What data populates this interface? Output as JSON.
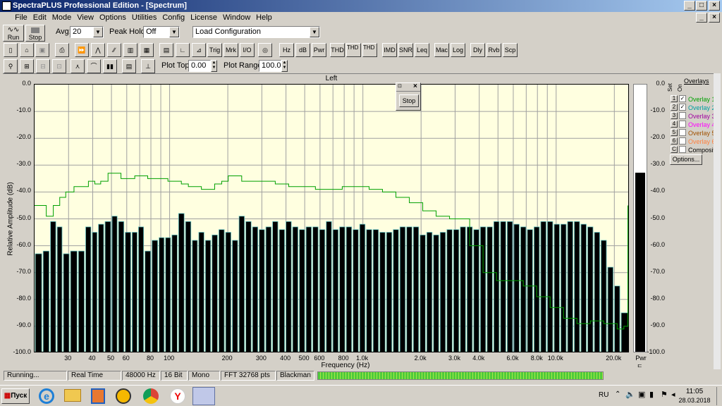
{
  "window": {
    "title": "SpectraPLUS Professional Edition - [Spectrum]",
    "menu": [
      "File",
      "Edit",
      "Mode",
      "View",
      "Options",
      "Utilities",
      "Config",
      "License",
      "Window",
      "Help"
    ]
  },
  "toolbar": {
    "run_label": "Run",
    "stop_label": "Stop",
    "avg_label": "Avg:",
    "avg_value": "20",
    "peak_hold_label": "Peak Hold:",
    "peak_hold_value": "Off",
    "config_value": "Load Configuration",
    "buttons_row2": [
      "Trig",
      "Mrk",
      "I/O",
      "Hz",
      "dB",
      "Pwr",
      "THD",
      "THD +N",
      "THD Freq",
      "IMD",
      "SNR",
      "Leq",
      "Mac",
      "Log",
      "Dly",
      "Rvb",
      "Scp"
    ],
    "plot_top_label": "Plot Top:",
    "plot_top_value": "0.00",
    "plot_range_label": "Plot Range:",
    "plot_range_value": "100.0"
  },
  "plot": {
    "channel_title": "Left",
    "ylabel": "Relative Amplitude (dB)",
    "xlabel": "Frequency (Hz)",
    "right_label": "Pwr",
    "floating_stop_label": "Stop",
    "y_ticks": [
      "0.0",
      "-10.0",
      "-20.0",
      "-30.0",
      "-40.0",
      "-50.0",
      "-60.0",
      "-70.0",
      "-80.0",
      "-90.0",
      "-100.0"
    ],
    "x_ticks": [
      "30",
      "40",
      "50",
      "60",
      "80",
      "100",
      "200",
      "300",
      "400",
      "500",
      "600",
      "800",
      "1.0k",
      "2.0k",
      "3.0k",
      "4.0k",
      "6.0k",
      "8.0k",
      "10.0k",
      "20.0k"
    ],
    "x_tick_freqs": [
      30,
      40,
      50,
      60,
      80,
      100,
      200,
      300,
      400,
      500,
      600,
      800,
      1000,
      2000,
      3000,
      4000,
      6000,
      8000,
      10000,
      20000
    ]
  },
  "overlays": {
    "title": "Overlays",
    "col_set": "Set",
    "col_on": "On",
    "items": [
      {
        "num": "1",
        "label": "Overlay 1",
        "checked": true,
        "color": "#00a000"
      },
      {
        "num": "2",
        "label": "Overlay 2",
        "checked": true,
        "color": "#00a0a0"
      },
      {
        "num": "3",
        "label": "Overlay 3",
        "checked": false,
        "color": "#a000a0"
      },
      {
        "num": "4",
        "label": "Overlay 4",
        "checked": false,
        "color": "#ff00ff"
      },
      {
        "num": "5",
        "label": "Overlay 5",
        "checked": false,
        "color": "#a05000"
      },
      {
        "num": "6",
        "label": "Overlay 6",
        "checked": false,
        "color": "#ff8040"
      },
      {
        "num": "C",
        "label": "Composite",
        "checked": false,
        "color": "#000000"
      }
    ],
    "options_label": "Options..."
  },
  "status": {
    "state": "Running...",
    "mode": "Real Time",
    "rate": "48000 Hz",
    "bits": "16 Bit",
    "channels": "Mono",
    "fft": "FFT 32768 pts",
    "window": "Blackman"
  },
  "taskbar": {
    "start_label": "Пуск",
    "lang": "RU",
    "time": "11:05",
    "date": "28.03.2018"
  },
  "chart_data": {
    "type": "bar",
    "ylim": [
      -100,
      0
    ],
    "xlim_hz": [
      20,
      24000
    ],
    "x_scale": "log",
    "bar_freqs": [
      21,
      23,
      25,
      27,
      29,
      32,
      35,
      38,
      41,
      44,
      48,
      52,
      56,
      61,
      66,
      71,
      77,
      84,
      91,
      98,
      106,
      115,
      125,
      135,
      146,
      158,
      171,
      186,
      201,
      218,
      236,
      256,
      277,
      300,
      325,
      352,
      381,
      413,
      447,
      484,
      525,
      568,
      616,
      667,
      722,
      782,
      847,
      918,
      994,
      1077,
      1166,
      1263,
      1368,
      1482,
      1605,
      1739,
      1883,
      2040,
      2210,
      2393,
      2592,
      2808,
      3041,
      3294,
      3568,
      3865,
      4186,
      4534,
      4911,
      5320,
      5762,
      6241,
      6760,
      7322,
      7931,
      8591,
      9305,
      10079,
      10917,
      11825,
      12808,
      13873,
      15027,
      16276,
      17630,
      19096,
      20684,
      22404
    ],
    "bar_values": [
      -63,
      -62,
      -51,
      -53,
      -63,
      -62,
      -62,
      -53,
      -55,
      -52,
      -51,
      -49,
      -51,
      -55,
      -55,
      -53,
      -62,
      -58,
      -57,
      -57,
      -56,
      -48,
      -51,
      -58,
      -55,
      -58,
      -56,
      -54,
      -55,
      -58,
      -49,
      -51,
      -53,
      -54,
      -53,
      -51,
      -54,
      -51,
      -53,
      -54,
      -53,
      -53,
      -54,
      -51,
      -54,
      -53,
      -53,
      -54,
      -52,
      -54,
      -54,
      -55,
      -55,
      -54,
      -53,
      -53,
      -53,
      -56,
      -55,
      -56,
      -55,
      -54,
      -54,
      -53,
      -53,
      -54,
      -53,
      -53,
      -51,
      -51,
      -51,
      -52,
      -53,
      -54,
      -53,
      -51,
      -51,
      -52,
      -52,
      -51,
      -51,
      -52,
      -53,
      -55,
      -58,
      -68,
      -75,
      -85
    ],
    "overlay1": [
      [
        20,
        -45
      ],
      [
        22,
        -45
      ],
      [
        23,
        -49
      ],
      [
        25,
        -45
      ],
      [
        27,
        -42
      ],
      [
        29,
        -40
      ],
      [
        32,
        -38
      ],
      [
        35,
        -38
      ],
      [
        38,
        -36
      ],
      [
        41,
        -37
      ],
      [
        44,
        -36
      ],
      [
        48,
        -33
      ],
      [
        52,
        -33
      ],
      [
        56,
        -35
      ],
      [
        61,
        -35
      ],
      [
        66,
        -34
      ],
      [
        71,
        -34
      ],
      [
        77,
        -35
      ],
      [
        84,
        -35
      ],
      [
        91,
        -35
      ],
      [
        98,
        -36
      ],
      [
        106,
        -36
      ],
      [
        115,
        -37
      ],
      [
        125,
        -38
      ],
      [
        135,
        -38
      ],
      [
        146,
        -39
      ],
      [
        158,
        -39
      ],
      [
        171,
        -37
      ],
      [
        186,
        -36
      ],
      [
        201,
        -34
      ],
      [
        218,
        -34
      ],
      [
        236,
        -36
      ],
      [
        256,
        -36
      ],
      [
        300,
        -36
      ],
      [
        352,
        -37
      ],
      [
        413,
        -38
      ],
      [
        484,
        -38
      ],
      [
        568,
        -39
      ],
      [
        667,
        -39
      ],
      [
        782,
        -38
      ],
      [
        918,
        -38
      ],
      [
        1077,
        -39
      ],
      [
        1263,
        -40
      ],
      [
        1482,
        -42
      ],
      [
        1739,
        -44
      ],
      [
        2040,
        -47
      ],
      [
        2393,
        -49
      ],
      [
        2808,
        -50
      ],
      [
        3294,
        -50
      ],
      [
        3568,
        -60
      ],
      [
        4186,
        -70
      ],
      [
        4911,
        -73
      ],
      [
        5762,
        -73
      ],
      [
        6760,
        -75
      ],
      [
        7931,
        -79
      ],
      [
        9305,
        -83
      ],
      [
        10917,
        -87
      ],
      [
        12808,
        -89
      ],
      [
        15027,
        -88
      ],
      [
        17630,
        -89
      ],
      [
        20684,
        -91
      ],
      [
        22404,
        -90
      ],
      [
        23500,
        -45
      ]
    ],
    "right_meter_level": -33
  }
}
